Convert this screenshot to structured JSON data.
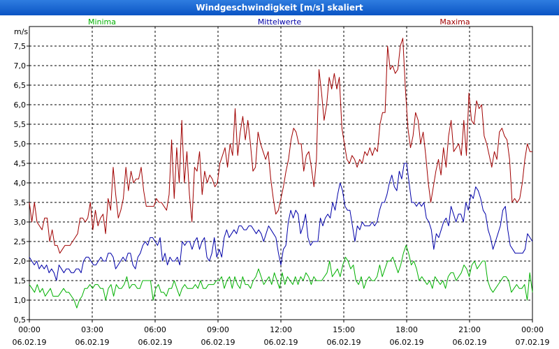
{
  "window": {
    "title": "Windgeschwindigkeit [m/s] skaliert"
  },
  "chart_data": {
    "type": "line",
    "title": "Windgeschwindigkeit [m/s] skaliert",
    "ylabel": "m/s",
    "ylim": [
      0.5,
      8.0
    ],
    "yticks": [
      "0,5",
      "1,0",
      "1,5",
      "2,0",
      "2,5",
      "3,0",
      "3,5",
      "4,0",
      "4,5",
      "5,0",
      "5,5",
      "6,0",
      "6,5",
      "7,0",
      "7,5"
    ],
    "xlim": [
      0,
      24
    ],
    "xticks": [
      {
        "time": "00:00",
        "date": "06.02.19"
      },
      {
        "time": "03:00",
        "date": "06.02.19"
      },
      {
        "time": "06:00",
        "date": "06.02.19"
      },
      {
        "time": "09:00",
        "date": "06.02.19"
      },
      {
        "time": "12:00",
        "date": "06.02.19"
      },
      {
        "time": "15:00",
        "date": "06.02.19"
      },
      {
        "time": "18:00",
        "date": "06.02.19"
      },
      {
        "time": "21:00",
        "date": "06.02.19"
      },
      {
        "time": "00:00",
        "date": "07.02.19"
      }
    ],
    "grid": true,
    "legend_position": "top",
    "series": [
      {
        "name": "Minima",
        "color": "#00b000",
        "values": [
          1.4,
          1.3,
          1.2,
          1.4,
          1.2,
          1.3,
          1.1,
          1.2,
          1.3,
          1.1,
          1.1,
          1.1,
          1.2,
          1.3,
          1.2,
          1.2,
          1.1,
          1.0,
          0.8,
          1.0,
          1.1,
          1.3,
          1.3,
          1.4,
          1.3,
          1.4,
          1.4,
          1.3,
          1.3,
          1.0,
          1.3,
          1.4,
          1.1,
          1.4,
          1.3,
          1.3,
          1.4,
          1.6,
          1.3,
          1.4,
          1.4,
          1.3,
          1.3,
          1.5,
          1.5,
          1.5,
          1.5,
          1.0,
          1.3,
          1.4,
          1.2,
          1.2,
          1.1,
          1.3,
          1.3,
          1.5,
          1.3,
          1.1,
          1.3,
          1.4,
          1.3,
          1.3,
          1.3,
          1.4,
          1.3,
          1.5,
          1.3,
          1.3,
          1.4,
          1.4,
          1.4,
          1.5,
          1.5,
          1.6,
          1.3,
          1.5,
          1.6,
          1.3,
          1.6,
          1.4,
          1.3,
          1.6,
          1.4,
          1.4,
          1.3,
          1.5,
          1.6,
          1.8,
          1.6,
          1.4,
          1.5,
          1.6,
          1.4,
          1.7,
          1.5,
          1.3,
          1.7,
          1.4,
          1.6,
          1.5,
          1.4,
          1.6,
          1.4,
          1.6,
          1.5,
          1.7,
          1.6,
          1.4,
          1.6,
          1.5,
          1.5,
          1.5,
          1.6,
          1.7,
          2.0,
          1.6,
          1.7,
          1.8,
          1.6,
          1.9,
          2.1,
          2.0,
          1.8,
          1.9,
          1.5,
          1.4,
          1.6,
          1.3,
          1.5,
          1.6,
          1.5,
          1.5,
          1.6,
          1.9,
          1.6,
          1.8,
          2.0,
          2.0,
          2.1,
          1.9,
          1.7,
          1.9,
          2.2,
          2.4,
          2.2,
          1.9,
          2.0,
          1.8,
          1.5,
          1.6,
          1.5,
          1.4,
          1.5,
          1.3,
          1.6,
          1.5,
          1.4,
          1.5,
          1.3,
          1.6,
          1.7,
          1.7,
          1.5,
          1.6,
          1.7,
          1.9,
          1.8,
          1.6,
          1.9,
          2.0,
          1.8,
          1.9,
          2.0,
          2.0,
          1.5,
          1.3,
          1.2,
          1.3,
          1.4,
          1.5,
          1.6,
          1.6,
          1.5,
          1.2,
          1.3,
          1.4,
          1.3,
          1.3,
          1.4,
          1.0,
          1.7,
          1.2
        ]
      },
      {
        "name": "Mittelwerte",
        "color": "#0000a8",
        "values": [
          2.1,
          2.0,
          1.9,
          2.0,
          1.8,
          1.9,
          1.8,
          1.9,
          1.7,
          1.8,
          1.7,
          1.5,
          1.9,
          1.8,
          1.7,
          1.8,
          1.8,
          1.7,
          1.7,
          1.8,
          1.8,
          1.7,
          2.0,
          2.1,
          2.1,
          2.0,
          1.9,
          1.9,
          2.0,
          2.1,
          2.0,
          2.0,
          2.2,
          2.2,
          2.1,
          1.8,
          1.9,
          2.0,
          2.1,
          2.0,
          2.2,
          2.2,
          1.9,
          1.8,
          2.1,
          2.2,
          2.4,
          2.5,
          2.4,
          2.6,
          2.6,
          2.5,
          2.4,
          2.6,
          2.0,
          2.2,
          1.9,
          2.1,
          2.0,
          2.0,
          2.1,
          1.9,
          2.5,
          2.4,
          2.5,
          2.5,
          2.3,
          2.5,
          2.6,
          2.3,
          2.5,
          2.6,
          2.1,
          2.0,
          2.2,
          2.6,
          2.1,
          2.3,
          2.1,
          2.6,
          2.8,
          2.6,
          2.7,
          2.8,
          2.7,
          2.9,
          2.9,
          2.8,
          2.8,
          2.9,
          2.9,
          2.8,
          2.7,
          2.8,
          2.7,
          2.5,
          2.7,
          2.9,
          2.8,
          2.7,
          2.6,
          2.2,
          1.9,
          2.3,
          2.4,
          3.0,
          3.3,
          3.1,
          3.3,
          3.2,
          2.7,
          2.9,
          3.2,
          2.6,
          2.4,
          2.5,
          2.5,
          2.5,
          3.1,
          2.9,
          3.1,
          3.2,
          3.1,
          3.5,
          3.3,
          3.7,
          4.0,
          3.8,
          3.4,
          3.3,
          3.3,
          2.9,
          2.5,
          2.9,
          2.8,
          3.0,
          2.9,
          2.9,
          2.9,
          3.0,
          2.9,
          3.0,
          3.3,
          3.5,
          3.5,
          3.7,
          4.0,
          4.2,
          3.9,
          3.8,
          4.3,
          4.1,
          4.5,
          4.5,
          4.0,
          3.5,
          3.5,
          3.4,
          3.5,
          3.4,
          3.5,
          3.1,
          3.0,
          2.8,
          2.3,
          2.7,
          2.6,
          2.8,
          3.0,
          3.1,
          2.9,
          3.4,
          3.2,
          3.0,
          3.2,
          3.2,
          3.0,
          3.5,
          3.3,
          3.7,
          3.6,
          3.9,
          3.8,
          3.6,
          3.3,
          3.2,
          2.8,
          2.6,
          2.3,
          2.5,
          2.7,
          2.9,
          3.3,
          3.4,
          2.8,
          2.4,
          2.3,
          2.2,
          2.2,
          2.2,
          2.2,
          2.3,
          2.7,
          2.6,
          2.5
        ]
      },
      {
        "name": "Maxima",
        "color": "#a00000",
        "values": [
          3.5,
          3.0,
          3.5,
          3.0,
          2.9,
          2.8,
          3.1,
          3.1,
          2.5,
          2.8,
          2.4,
          2.4,
          2.2,
          2.3,
          2.4,
          2.4,
          2.4,
          2.5,
          2.6,
          2.7,
          3.1,
          3.1,
          3.0,
          3.1,
          3.5,
          2.8,
          3.3,
          2.9,
          3.1,
          3.2,
          2.7,
          3.6,
          3.3,
          4.4,
          3.7,
          3.1,
          3.3,
          3.6,
          4.4,
          3.8,
          4.3,
          4.0,
          4.1,
          4.1,
          4.4,
          3.8,
          3.4,
          3.4,
          3.4,
          3.4,
          3.6,
          3.5,
          3.5,
          3.4,
          3.3,
          3.7,
          5.1,
          3.6,
          4.9,
          4.0,
          5.6,
          4.0,
          4.8,
          3.7,
          3.0,
          4.4,
          4.3,
          4.8,
          3.7,
          4.3,
          4.0,
          4.2,
          4.1,
          3.9,
          4.0,
          4.5,
          4.7,
          4.9,
          4.4,
          5.0,
          4.7,
          5.9,
          4.7,
          5.3,
          5.7,
          5.1,
          5.6,
          5.0,
          4.3,
          4.4,
          5.3,
          5.0,
          4.8,
          4.6,
          4.8,
          4.1,
          3.6,
          3.2,
          3.3,
          3.6,
          3.9,
          4.3,
          4.6,
          5.1,
          5.4,
          5.3,
          5.0,
          5.0,
          4.3,
          4.7,
          4.8,
          4.4,
          3.9,
          4.6,
          6.9,
          6.3,
          5.6,
          6.0,
          6.7,
          6.4,
          6.8,
          6.4,
          6.7,
          5.4,
          5.0,
          4.6,
          4.5,
          4.7,
          4.6,
          4.4,
          4.6,
          4.5,
          4.8,
          4.7,
          4.9,
          4.7,
          4.9,
          4.8,
          5.5,
          5.8,
          5.8,
          7.5,
          6.9,
          7.0,
          6.8,
          6.9,
          7.5,
          7.7,
          6.4,
          5.4,
          4.9,
          5.2,
          5.8,
          5.6,
          5.0,
          5.3,
          4.7,
          4.0,
          3.5,
          3.9,
          4.3,
          4.6,
          4.2,
          4.9,
          4.4,
          5.2,
          5.6,
          4.8,
          4.9,
          5.0,
          4.7,
          5.6,
          4.7,
          6.3,
          5.6,
          5.5,
          6.1,
          5.9,
          6.0,
          5.2,
          5.0,
          4.7,
          4.4,
          4.8,
          4.6,
          5.3,
          5.4,
          5.2,
          5.1,
          4.6,
          3.5,
          3.6,
          3.5,
          3.6,
          4.0,
          4.6,
          5.0,
          4.8,
          4.8
        ]
      }
    ]
  }
}
